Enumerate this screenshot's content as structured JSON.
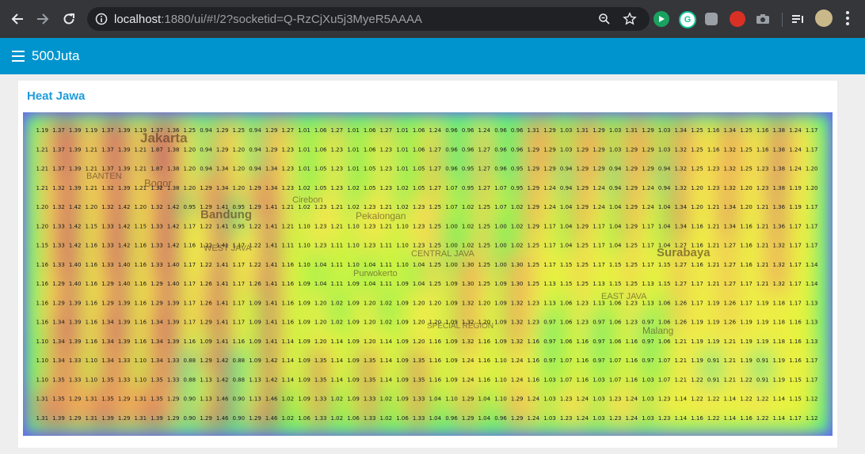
{
  "browser": {
    "url_host": "localhost",
    "url_rest": ":1880/ui/#!/2?socketid=Q-RzCjXu5j3MyeR5AAAA"
  },
  "app": {
    "title": "500Juta"
  },
  "card": {
    "title": "Heat Jawa"
  },
  "map_labels": [
    {
      "text": "Jakarta"
    },
    {
      "text": "Bogor"
    },
    {
      "text": "Bandung"
    },
    {
      "text": "Cirebon"
    },
    {
      "text": "Pekalongan"
    },
    {
      "text": "CENTRAL JAVA"
    },
    {
      "text": "Purwokerto"
    },
    {
      "text": "Surabaya"
    },
    {
      "text": "EAST JAVA"
    },
    {
      "text": "Malang"
    },
    {
      "text": "BANTEN"
    },
    {
      "text": "WEST JAVA"
    },
    {
      "text": "SPECIAL REGION"
    }
  ],
  "chart_data": {
    "type": "heatmap",
    "rows": [
      [
        1.19,
        1.37,
        1.39,
        1.19,
        1.37,
        1.39,
        1.19,
        1.37,
        1.36,
        1.25,
        0.94,
        1.29,
        1.25,
        0.94,
        1.29,
        1.27,
        1.01,
        1.06,
        1.27,
        1.01,
        1.06,
        1.27,
        1.01,
        1.06,
        1.24,
        0.96,
        0.96,
        1.24,
        0.96,
        0.96,
        1.31,
        1.29,
        1.03,
        1.31,
        1.29,
        1.03,
        1.31,
        1.29,
        1.03,
        1.34,
        1.25,
        1.16,
        1.34,
        1.25,
        1.16,
        1.38,
        1.24,
        1.17
      ],
      [
        1.21,
        1.37,
        1.39,
        1.21,
        1.37,
        1.39,
        1.21,
        1.87,
        1.38,
        1.2,
        0.94,
        1.29,
        1.2,
        0.94,
        1.29,
        1.23,
        1.01,
        1.06,
        1.23,
        1.01,
        1.06,
        1.23,
        1.01,
        1.06,
        1.27,
        0.96,
        0.96,
        1.27,
        0.96,
        0.96,
        1.29,
        1.29,
        1.03,
        1.29,
        1.29,
        1.03,
        1.29,
        1.29,
        1.03,
        1.32,
        1.25,
        1.16,
        1.32,
        1.25,
        1.16,
        1.38,
        1.24,
        1.17
      ],
      [
        1.21,
        1.37,
        1.39,
        1.21,
        1.37,
        1.39,
        1.21,
        1.87,
        1.38,
        1.2,
        0.94,
        1.34,
        1.2,
        0.94,
        1.34,
        1.23,
        1.01,
        1.05,
        1.23,
        1.01,
        1.05,
        1.23,
        1.01,
        1.05,
        1.27,
        0.96,
        0.95,
        1.27,
        0.96,
        0.95,
        1.29,
        1.29,
        0.94,
        1.29,
        1.29,
        0.94,
        1.29,
        1.29,
        0.94,
        1.32,
        1.25,
        1.23,
        1.32,
        1.25,
        1.23,
        1.38,
        1.24,
        1.2
      ],
      [
        1.21,
        1.32,
        1.39,
        1.21,
        1.32,
        1.39,
        1.21,
        1.32,
        1.38,
        1.2,
        1.29,
        1.34,
        1.2,
        1.29,
        1.34,
        1.23,
        1.02,
        1.05,
        1.23,
        1.02,
        1.05,
        1.23,
        1.02,
        1.05,
        1.27,
        1.07,
        0.95,
        1.27,
        1.07,
        0.95,
        1.29,
        1.24,
        0.94,
        1.29,
        1.24,
        0.94,
        1.29,
        1.24,
        0.94,
        1.32,
        1.2,
        1.23,
        1.32,
        1.2,
        1.23,
        1.38,
        1.19,
        1.2
      ],
      [
        1.2,
        1.32,
        1.42,
        1.2,
        1.32,
        1.42,
        1.2,
        1.32,
        1.42,
        0.95,
        1.29,
        1.41,
        0.95,
        1.29,
        1.41,
        1.21,
        1.02,
        1.23,
        1.21,
        1.02,
        1.23,
        1.21,
        1.02,
        1.23,
        1.25,
        1.07,
        1.02,
        1.25,
        1.07,
        1.02,
        1.29,
        1.24,
        1.04,
        1.29,
        1.24,
        1.04,
        1.29,
        1.24,
        1.04,
        1.34,
        1.2,
        1.21,
        1.34,
        1.2,
        1.21,
        1.36,
        1.19,
        1.17
      ],
      [
        1.2,
        1.33,
        1.42,
        1.15,
        1.33,
        1.42,
        1.15,
        1.33,
        1.42,
        1.17,
        1.22,
        1.41,
        0.95,
        1.22,
        1.41,
        1.21,
        1.1,
        1.23,
        1.21,
        1.1,
        1.23,
        1.21,
        1.1,
        1.23,
        1.25,
        1.0,
        1.02,
        1.25,
        1.0,
        1.02,
        1.29,
        1.17,
        1.04,
        1.29,
        1.17,
        1.04,
        1.29,
        1.17,
        1.04,
        1.34,
        1.16,
        1.21,
        1.34,
        1.16,
        1.21,
        1.36,
        1.17,
        1.17
      ],
      [
        1.15,
        1.33,
        1.42,
        1.16,
        1.33,
        1.42,
        1.16,
        1.33,
        1.42,
        1.16,
        1.22,
        1.41,
        1.17,
        1.22,
        1.41,
        1.11,
        1.1,
        1.23,
        1.11,
        1.1,
        1.23,
        1.11,
        1.1,
        1.23,
        1.25,
        1.0,
        1.02,
        1.25,
        1.0,
        1.02,
        1.25,
        1.17,
        1.04,
        1.25,
        1.17,
        1.04,
        1.25,
        1.17,
        1.04,
        1.27,
        1.16,
        1.21,
        1.27,
        1.16,
        1.21,
        1.32,
        1.17,
        1.17
      ],
      [
        1.16,
        1.33,
        1.4,
        1.16,
        1.33,
        1.4,
        1.16,
        1.33,
        1.4,
        1.17,
        1.22,
        1.41,
        1.17,
        1.22,
        1.41,
        1.16,
        1.1,
        1.04,
        1.11,
        1.1,
        1.04,
        1.11,
        1.1,
        1.04,
        1.25,
        1.0,
        1.3,
        1.25,
        1.0,
        1.3,
        1.25,
        1.17,
        1.15,
        1.25,
        1.17,
        1.15,
        1.25,
        1.17,
        1.15,
        1.27,
        1.16,
        1.21,
        1.27,
        1.16,
        1.21,
        1.32,
        1.17,
        1.14
      ],
      [
        1.16,
        1.29,
        1.4,
        1.16,
        1.29,
        1.4,
        1.16,
        1.29,
        1.4,
        1.17,
        1.26,
        1.41,
        1.17,
        1.26,
        1.41,
        1.16,
        1.09,
        1.04,
        1.11,
        1.09,
        1.04,
        1.11,
        1.09,
        1.04,
        1.25,
        1.09,
        1.3,
        1.25,
        1.09,
        1.3,
        1.25,
        1.13,
        1.15,
        1.25,
        1.13,
        1.15,
        1.25,
        1.13,
        1.15,
        1.27,
        1.17,
        1.21,
        1.27,
        1.17,
        1.21,
        1.32,
        1.17,
        1.14
      ],
      [
        1.16,
        1.29,
        1.39,
        1.16,
        1.29,
        1.39,
        1.16,
        1.29,
        1.39,
        1.17,
        1.26,
        1.41,
        1.17,
        1.09,
        1.41,
        1.16,
        1.09,
        1.2,
        1.02,
        1.09,
        1.2,
        1.02,
        1.09,
        1.2,
        1.2,
        1.09,
        1.32,
        1.2,
        1.09,
        1.32,
        1.23,
        1.13,
        1.06,
        1.23,
        1.13,
        1.06,
        1.23,
        1.13,
        1.06,
        1.26,
        1.17,
        1.19,
        1.26,
        1.17,
        1.19,
        1.18,
        1.17,
        1.13
      ],
      [
        1.16,
        1.34,
        1.39,
        1.16,
        1.34,
        1.39,
        1.16,
        1.34,
        1.39,
        1.17,
        1.29,
        1.41,
        1.17,
        1.09,
        1.41,
        1.16,
        1.09,
        1.2,
        1.02,
        1.09,
        1.2,
        1.02,
        1.09,
        1.2,
        1.2,
        1.09,
        1.32,
        1.2,
        1.09,
        1.32,
        1.23,
        0.97,
        1.06,
        1.23,
        0.97,
        1.06,
        1.23,
        0.97,
        1.06,
        1.26,
        1.19,
        1.19,
        1.26,
        1.19,
        1.19,
        1.18,
        1.16,
        1.13
      ],
      [
        1.1,
        1.34,
        1.39,
        1.16,
        1.34,
        1.39,
        1.16,
        1.34,
        1.39,
        1.16,
        1.09,
        1.41,
        1.16,
        1.09,
        1.41,
        1.14,
        1.09,
        1.2,
        1.14,
        1.09,
        1.2,
        1.14,
        1.09,
        1.2,
        1.16,
        1.09,
        1.32,
        1.16,
        1.09,
        1.32,
        1.16,
        0.97,
        1.06,
        1.16,
        0.97,
        1.06,
        1.16,
        0.97,
        1.06,
        1.21,
        1.19,
        1.19,
        1.21,
        1.19,
        1.19,
        1.18,
        1.16,
        1.13
      ],
      [
        1.1,
        1.34,
        1.33,
        1.1,
        1.34,
        1.33,
        1.1,
        1.34,
        1.33,
        0.88,
        1.29,
        1.42,
        0.88,
        1.09,
        1.42,
        1.14,
        1.09,
        1.35,
        1.14,
        1.09,
        1.35,
        1.14,
        1.09,
        1.35,
        1.16,
        1.09,
        1.24,
        1.16,
        1.1,
        1.24,
        1.16,
        0.97,
        1.07,
        1.16,
        0.97,
        1.07,
        1.16,
        0.97,
        1.07,
        1.21,
        1.19,
        0.91,
        1.21,
        1.19,
        0.91,
        1.19,
        1.16,
        1.17
      ],
      [
        1.1,
        1.35,
        1.33,
        1.1,
        1.35,
        1.33,
        1.1,
        1.35,
        1.33,
        0.88,
        1.13,
        1.42,
        0.88,
        1.13,
        1.42,
        1.14,
        1.09,
        1.35,
        1.14,
        1.09,
        1.35,
        1.14,
        1.09,
        1.35,
        1.16,
        1.09,
        1.24,
        1.16,
        1.1,
        1.24,
        1.16,
        1.03,
        1.07,
        1.16,
        1.03,
        1.07,
        1.16,
        1.03,
        1.07,
        1.21,
        1.22,
        0.91,
        1.21,
        1.22,
        0.91,
        1.19,
        1.15,
        1.17
      ],
      [
        1.31,
        1.35,
        1.29,
        1.31,
        1.35,
        1.29,
        1.31,
        1.35,
        1.29,
        0.9,
        1.13,
        1.46,
        0.9,
        1.13,
        1.46,
        1.02,
        1.09,
        1.33,
        1.02,
        1.09,
        1.33,
        1.02,
        1.09,
        1.33,
        1.04,
        1.1,
        1.29,
        1.04,
        1.1,
        1.29,
        1.24,
        1.03,
        1.23,
        1.24,
        1.03,
        1.23,
        1.24,
        1.03,
        1.23,
        1.14,
        1.22,
        1.22,
        1.14,
        1.22,
        1.22,
        1.14,
        1.15,
        1.12
      ],
      [
        1.31,
        1.39,
        1.29,
        1.31,
        1.39,
        1.29,
        1.31,
        1.39,
        1.29,
        0.9,
        1.29,
        1.46,
        0.9,
        1.29,
        1.46,
        1.02,
        1.06,
        1.33,
        1.02,
        1.06,
        1.33,
        1.02,
        1.06,
        1.33,
        1.04,
        0.96,
        1.29,
        1.04,
        0.96,
        1.29,
        1.24,
        1.03,
        1.23,
        1.24,
        1.03,
        1.23,
        1.24,
        1.03,
        1.23,
        1.14,
        1.16,
        1.22,
        1.14,
        1.16,
        1.22,
        1.14,
        1.17,
        1.12
      ]
    ],
    "min": 0.88,
    "max": 1.46
  }
}
